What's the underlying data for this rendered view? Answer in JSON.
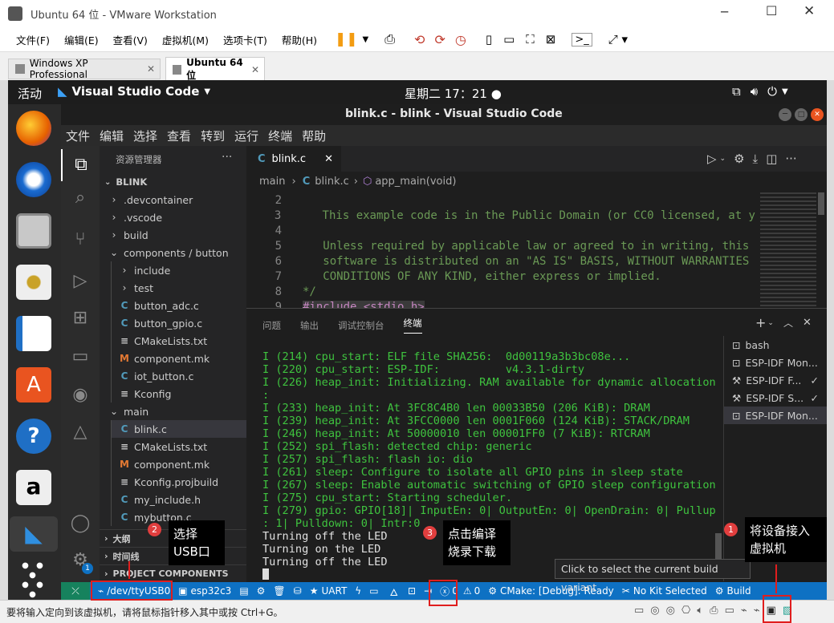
{
  "vmware": {
    "title": "Ubuntu 64 位 - VMware Workstation",
    "menu": [
      "文件(F)",
      "编辑(E)",
      "查看(V)",
      "虚拟机(M)",
      "选项卡(T)",
      "帮助(H)"
    ],
    "tabs": [
      "Windows XP Professional",
      "Ubuntu 64 位"
    ],
    "status_text": "要将输入定向到该虚拟机，请将鼠标指针移入其中或按 Ctrl+G。"
  },
  "gnome": {
    "activities": "活动",
    "app_name": "Visual Studio Code",
    "clock": "星期二 17：21"
  },
  "vscode": {
    "window_title": "blink.c - blink - Visual Studio Code",
    "menu": [
      "文件",
      "编辑",
      "选择",
      "查看",
      "转到",
      "运行",
      "终端",
      "帮助"
    ],
    "explorer_title": "资源管理器",
    "root": "BLINK",
    "tree": [
      {
        "label": ".devcontainer",
        "kind": "folder",
        "depth": 1,
        "open": false
      },
      {
        "label": ".vscode",
        "kind": "folder",
        "depth": 1,
        "open": false
      },
      {
        "label": "build",
        "kind": "folder",
        "depth": 1,
        "open": false
      },
      {
        "label": "components / button",
        "kind": "folder",
        "depth": 1,
        "open": true
      },
      {
        "label": "include",
        "kind": "folder",
        "depth": 2,
        "open": false
      },
      {
        "label": "test",
        "kind": "folder",
        "depth": 2,
        "open": false
      },
      {
        "label": "button_adc.c",
        "kind": "c",
        "depth": 2
      },
      {
        "label": "button_gpio.c",
        "kind": "c",
        "depth": 2
      },
      {
        "label": "CMakeLists.txt",
        "kind": "cmake",
        "depth": 2
      },
      {
        "label": "component.mk",
        "kind": "mk",
        "depth": 2
      },
      {
        "label": "iot_button.c",
        "kind": "c",
        "depth": 2
      },
      {
        "label": "Kconfig",
        "kind": "kconfig",
        "depth": 2
      },
      {
        "label": "main",
        "kind": "folder",
        "depth": 1,
        "open": true
      },
      {
        "label": "blink.c",
        "kind": "c",
        "depth": 2,
        "selected": true
      },
      {
        "label": "CMakeLists.txt",
        "kind": "cmake",
        "depth": 2
      },
      {
        "label": "component.mk",
        "kind": "mk",
        "depth": 2
      },
      {
        "label": "Kconfig.projbuild",
        "kind": "kconfig",
        "depth": 2
      },
      {
        "label": "my_include.h",
        "kind": "c",
        "depth": 2
      },
      {
        "label": "mybutton.c",
        "kind": "c",
        "depth": 2
      }
    ],
    "outline_label": "大纲",
    "timeline_label": "时间线",
    "project_components_label": "PROJECT COMPONENTS",
    "editor_tab": "blink.c",
    "breadcrumb": [
      "main",
      "blink.c",
      "app_main(void)"
    ],
    "code": [
      {
        "n": "2",
        "t": ""
      },
      {
        "n": "3",
        "t": "   This example code is in the Public Domain (or CC0 licensed, at y"
      },
      {
        "n": "4",
        "t": ""
      },
      {
        "n": "5",
        "t": "   Unless required by applicable law or agreed to in writing, this"
      },
      {
        "n": "6",
        "t": "   software is distributed on an \"AS IS\" BASIS, WITHOUT WARRANTIES"
      },
      {
        "n": "7",
        "t": "   CONDITIONS OF ANY KIND, either express or implied."
      },
      {
        "n": "8",
        "t": "*/"
      },
      {
        "n": "9",
        "t": "#include <stdio.h>"
      }
    ],
    "panel_tabs": [
      "问题",
      "输出",
      "调试控制台",
      "终端"
    ],
    "terminal": [
      "I (214) cpu_start: ELF file SHA256:  0d00119a3b3bc08e...",
      "I (220) cpu_start: ESP-IDF:          v4.3.1-dirty",
      "I (226) heap_init: Initializing. RAM available for dynamic allocation",
      ":",
      "I (233) heap_init: At 3FC8C4B0 len 00033B50 (206 KiB): DRAM",
      "I (239) heap_init: At 3FCC0000 len 0001F060 (124 KiB): STACK/DRAM",
      "I (246) heap_init: At 50000010 len 00001FF0 (7 KiB): RTCRAM",
      "I (252) spi_flash: detected chip: generic",
      "I (257) spi_flash: flash io: dio",
      "I (261) sleep: Configure to isolate all GPIO pins in sleep state",
      "I (267) sleep: Enable automatic switching of GPIO sleep configuration",
      "I (275) cpu_start: Starting scheduler.",
      "I (279) gpio: GPIO[18]| InputEn: 0| OutputEn: 0| OpenDrain: 0| Pullup",
      ": 1| Pulldown: 0| Intr:0",
      "Turning off the LED",
      "Turning on the LED",
      "Turning off the LED"
    ],
    "terminals": [
      {
        "label": "bash",
        "icon": "terminal",
        "check": false,
        "active": false
      },
      {
        "label": "ESP-IDF Mon...",
        "icon": "terminal",
        "check": false,
        "active": false
      },
      {
        "label": "ESP-IDF F...",
        "icon": "tools",
        "check": true,
        "active": false
      },
      {
        "label": "ESP-IDF S...",
        "icon": "tools",
        "check": true,
        "active": false
      },
      {
        "label": "ESP-IDF Mon...",
        "icon": "terminal",
        "check": false,
        "active": true
      }
    ],
    "tooltip": "Click to select the current build variant",
    "status": {
      "port": "/dev/ttyUSB0",
      "target": "esp32c3",
      "uart": "UART",
      "errors": "0",
      "warnings": "0",
      "cmake": "CMake: [Debug]: Ready",
      "kit": "No Kit Selected",
      "build": "Build"
    }
  },
  "annotations": [
    {
      "num": "1",
      "text": [
        "将设备接入",
        "虚拟机"
      ]
    },
    {
      "num": "2",
      "text": [
        "选择",
        "USB口"
      ]
    },
    {
      "num": "3",
      "text": [
        "点击编译",
        "烧录下载"
      ]
    }
  ],
  "colors": {
    "statusbar": "#0e71c3",
    "terminal_text": "#3fc33f",
    "comment": "#6a9955",
    "callout_badge": "#e13e3e",
    "highlight_box": "#e01e1e"
  }
}
